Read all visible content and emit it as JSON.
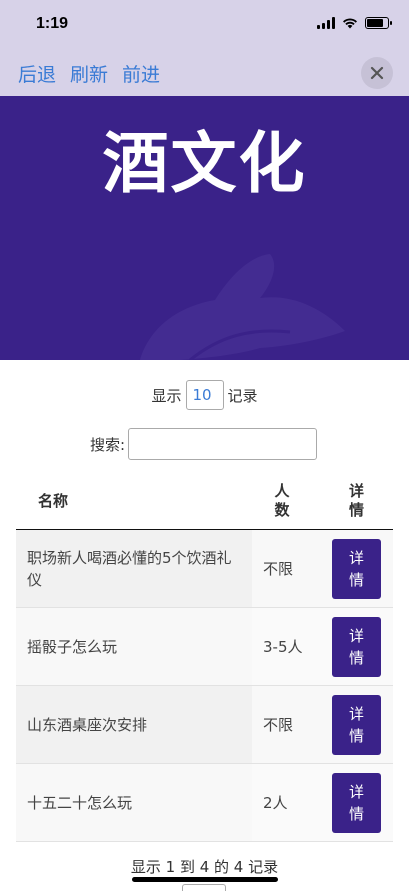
{
  "status_bar": {
    "time": "1:19"
  },
  "nav": {
    "back": "后退",
    "refresh": "刷新",
    "forward": "前进"
  },
  "banner": {
    "title": "酒文化"
  },
  "length": {
    "prefix": "显示",
    "value": "10",
    "suffix": "记录"
  },
  "search": {
    "label": "搜索:",
    "value": ""
  },
  "table": {
    "headers": {
      "name": "名称",
      "people": "人数",
      "detail": "详情"
    },
    "rows": [
      {
        "name": "职场新人喝酒必懂的5个饮酒礼仪",
        "people": "不限",
        "button": "详情"
      },
      {
        "name": "摇骰子怎么玩",
        "people": "3-5人",
        "button": "详情"
      },
      {
        "name": "山东酒桌座次安排",
        "people": "不限",
        "button": "详情"
      },
      {
        "name": "十五二十怎么玩",
        "people": "2人",
        "button": "详情"
      }
    ]
  },
  "info": "显示 1 到 4 的 4 记录",
  "colors": {
    "accent": "#3a2289",
    "link": "#3a7bd5",
    "nav_bg": "#d7d2e8"
  }
}
